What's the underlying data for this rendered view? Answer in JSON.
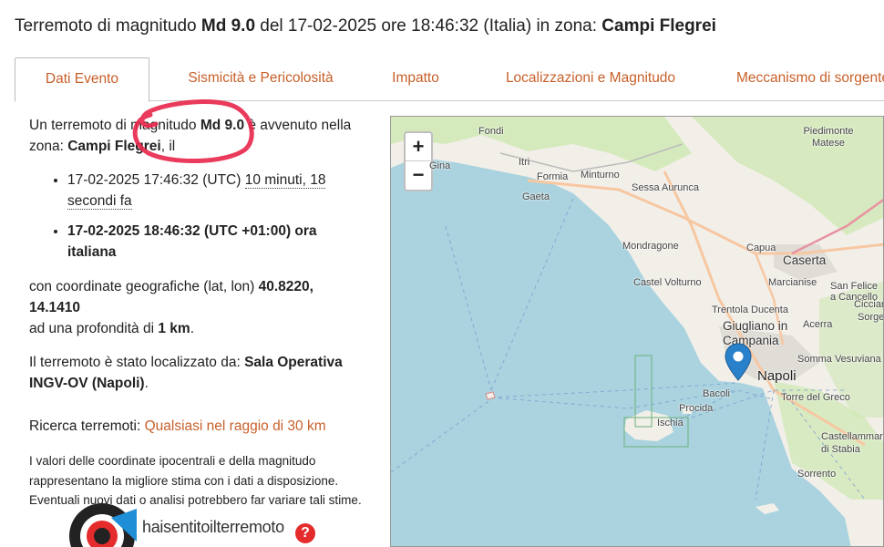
{
  "header": {
    "prefix": "Terremoto di magnitudo ",
    "magnitude": "Md 9.0",
    "middle": " del 17-02-2025 ore 18:46:32 (Italia) in zona: ",
    "zone": "Campi Flegrei"
  },
  "tabs": [
    {
      "label": "Dati Evento",
      "active": true
    },
    {
      "label": "Sismicità e Pericolosità",
      "active": false
    },
    {
      "label": "Impatto",
      "active": false
    },
    {
      "label": "Localizzazioni e Magnitudo",
      "active": false
    },
    {
      "label": "Meccanismo di sorgente",
      "active": false
    }
  ],
  "event": {
    "intro_1": "Un terremoto di magnitudo ",
    "magnitude": "Md 9.0",
    "intro_2": " è avvenuto nella zona: ",
    "zone": "Campi Flegrei",
    "intro_3": ", il",
    "utc_time": "17-02-2025 17:46:32 (UTC) ",
    "ago": "10 minuti, 18 secondi fa",
    "local_time": "17-02-2025 18:46:32 (UTC +01:00) ora italiana",
    "coord_prefix": "con coordinate geografiche (lat, lon) ",
    "coordinates": "40.8220, 14.1410",
    "depth_prefix": "ad una profondità di ",
    "depth": "1 km",
    "depth_suffix": ".",
    "located_prefix": "Il terremoto è stato localizzato da: ",
    "located_by": "Sala Operativa INGV-OV (Napoli)",
    "located_suffix": ".",
    "search_prefix": "Ricerca terremoti: ",
    "search_link": "Qualsiasi nel raggio di 30 km",
    "note": "I valori delle coordinate ipocentrali e della magnitudo rappresentano la migliore stima con i dati a disposizione. Eventuali nuovi dati o analisi potrebbero far variare tali stime."
  },
  "haisentito": {
    "brand": "haisentitoilterremoto",
    "help": "?"
  },
  "map": {
    "zoom_in": "+",
    "zoom_out": "−",
    "places": [
      "Fondi",
      "Itri",
      "Formia",
      "Minturno",
      "Gaeta",
      "Sessa Aurunca",
      "Mondragone",
      "Capua",
      "Caserta",
      "Castel Volturno",
      "Marcianise",
      "San Felice a Cancello",
      "Trentola Ducenta",
      "Acerra",
      "Giugliano in Campania",
      "Napoli",
      "Bacoli",
      "Procida",
      "Ischia",
      "Torre del Greco",
      "Somma Vesuviana",
      "Castellammare di Stabia",
      "Sorrento",
      "Piedimonte Matese",
      "Cicciano",
      "Sorgenti",
      "Gina"
    ],
    "colors": {
      "sea": "#aad3df",
      "land": "#f2efe9",
      "green": "#cde8b0",
      "road": "#f7c7a2",
      "marker": "#2a81cb"
    }
  }
}
